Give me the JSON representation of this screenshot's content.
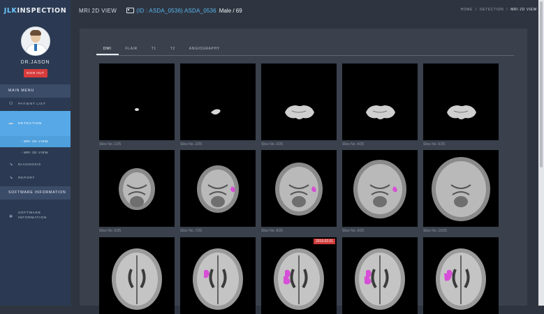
{
  "app": {
    "logo_prefix": "JLK",
    "logo_suffix": " INSPECTION"
  },
  "sidebar": {
    "user_name": "DR.JASON",
    "sign_out": "SIGN OUT",
    "main_menu": "MAIN MENU",
    "items": [
      {
        "label": "PATIENT LIST",
        "icon": "users-icon"
      },
      {
        "label": "DETECTION",
        "icon": "folder-icon"
      },
      {
        "label": "DIAGNOSIS",
        "icon": "wrench-icon"
      },
      {
        "label": "REPORT",
        "icon": "wrench-icon"
      }
    ],
    "sub_items": [
      "- MRI 2D VIEW",
      "- MRI 3D VIEW"
    ],
    "software_header": "SOFTWARE INFORMATION",
    "software_item": [
      "SOFTWARE",
      "INFORMATION"
    ]
  },
  "header": {
    "page_title": "MRI 2D VIEW",
    "patient_id": "(ID : ASDA_0536) ASDA_0536",
    "patient_demo": "Male / 69",
    "breadcrumb": [
      "HOME",
      "DETECTION",
      "MRI 2D VIEW"
    ]
  },
  "tabs": [
    "DWI",
    "FLAIR",
    "T1",
    "T2",
    "ANGIOGRAPHY"
  ],
  "active_tab": "DWI",
  "slices": [
    {
      "caption": "Slice No. 1/25"
    },
    {
      "caption": "Slice No. 2/25"
    },
    {
      "caption": "Slice No. 3/25"
    },
    {
      "caption": "Slice No. 4/25"
    },
    {
      "caption": "Slice No. 5/25"
    },
    {
      "caption": "Slice No. 6/25"
    },
    {
      "caption": "Slice No. 7/25"
    },
    {
      "caption": "Slice No. 8/25"
    },
    {
      "caption": "Slice No. 9/25"
    },
    {
      "caption": "Slice No. 10/25"
    },
    {
      "caption": ""
    },
    {
      "caption": ""
    },
    {
      "caption": "",
      "badge": "2019.02.01"
    },
    {
      "caption": ""
    },
    {
      "caption": ""
    }
  ],
  "colors": {
    "sidebar_bg": "#2b3a52",
    "active_menu": "#56a8e6",
    "lesion": "#d64fd6",
    "patient_id": "#56b6f0",
    "danger": "#d83b3b"
  }
}
